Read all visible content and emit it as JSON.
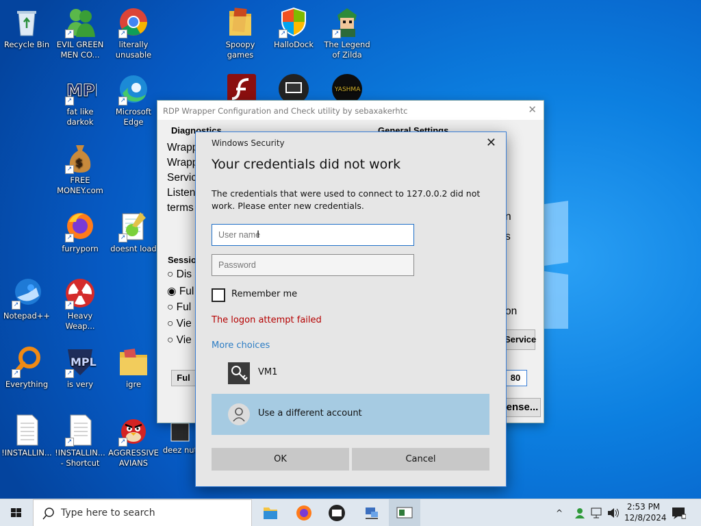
{
  "desktop": {
    "icons": [
      {
        "id": "recycle",
        "label": "Recycle Bin",
        "icon": "recycle-bin-icon",
        "shortcut": false
      },
      {
        "id": "evil",
        "label": "EVIL GREEN MEN CO...",
        "icon": "messenger-people-icon",
        "shortcut": true
      },
      {
        "id": "chrome",
        "label": "literally unusable",
        "icon": "chrome-icon",
        "shortcut": true
      },
      {
        "id": "spoopy",
        "label": "Spoopy games",
        "icon": "folder-icon",
        "shortcut": false
      },
      {
        "id": "hallodock",
        "label": "HalloDock",
        "icon": "shield-icon",
        "shortcut": true
      },
      {
        "id": "zilda",
        "label": "The Legend of Zilda",
        "icon": "game-character-icon",
        "shortcut": true
      },
      {
        "id": "fatlike",
        "label": "fat like darkok",
        "icon": "mpl-logo-icon",
        "shortcut": true
      },
      {
        "id": "edge",
        "label": "Microsoft Edge",
        "icon": "edge-icon",
        "shortcut": true
      },
      {
        "id": "flash",
        "label": "",
        "icon": "flash-icon",
        "shortcut": false
      },
      {
        "id": "rdpicon",
        "label": "",
        "icon": "rdp-monitor-icon",
        "shortcut": false
      },
      {
        "id": "yashma",
        "label": "",
        "icon": "yashma-icon",
        "shortcut": false
      },
      {
        "id": "money",
        "label": "FREE MONEY.com",
        "icon": "money-bag-icon",
        "shortcut": true
      },
      {
        "id": "firefox",
        "label": "furryporn",
        "icon": "firefox-icon",
        "shortcut": true
      },
      {
        "id": "notepad",
        "label": "Notepad++",
        "icon": "notepad-plus-icon",
        "shortcut": true
      },
      {
        "id": "thunder",
        "label": "doesnt load",
        "icon": "thunderbird-icon",
        "shortcut": true
      },
      {
        "id": "heavy",
        "label": "Heavy Weap...",
        "icon": "radiation-icon",
        "shortcut": true
      },
      {
        "id": "everything",
        "label": "Everything",
        "icon": "magnifier-icon",
        "shortcut": true
      },
      {
        "id": "isvery",
        "label": "is very",
        "icon": "mpl-shield-icon",
        "shortcut": true
      },
      {
        "id": "igre",
        "label": "igre",
        "icon": "folder-icon",
        "shortcut": false
      },
      {
        "id": "install1",
        "label": "!INSTALLIN...",
        "icon": "document-icon",
        "shortcut": false
      },
      {
        "id": "install2",
        "label": "!INSTALLIN... - Shortcut",
        "icon": "document-icon",
        "shortcut": true
      },
      {
        "id": "angry",
        "label": "AGGRESSIVE AVIANS",
        "icon": "angry-bird-icon",
        "shortcut": true
      },
      {
        "id": "deez",
        "label": "deez nut",
        "icon": "terminal-icon",
        "shortcut": false
      }
    ]
  },
  "rdp_window": {
    "title": "RDP Wrapper Configuration and Check utility by sebaxakerhtc",
    "diagnostics_label": "Diagnostics",
    "general_label": "General Settings",
    "diag_lines": [
      "Wrapp",
      "Wrapp",
      "Servic",
      "Listen",
      "terms"
    ],
    "session_label": "Sessio",
    "radios": [
      "Dis",
      "Ful",
      "Ful",
      "Vie",
      "Vie"
    ],
    "right_fragments": [
      "n",
      "s",
      "on"
    ],
    "service_btn": "Service",
    "port_value": "80",
    "full_btn": "Ful",
    "license_btn": "ense..."
  },
  "dialog": {
    "header": "Windows Security",
    "title": "Your credentials did not work",
    "message": "The credentials that were used to connect to 127.0.0.2 did not work. Please enter new credentials.",
    "username_placeholder": "User name",
    "password_placeholder": "Password",
    "remember_label": "Remember me",
    "remember_checked": false,
    "error": "The logon attempt failed",
    "more_choices": "More choices",
    "accounts": [
      {
        "label": "VM1",
        "icon": "key-icon",
        "selected": false
      },
      {
        "label": "Use a different account",
        "icon": "person-icon",
        "selected": true
      }
    ],
    "ok_label": "OK",
    "cancel_label": "Cancel",
    "accent_color": "#2b7cc4",
    "error_color": "#b50000"
  },
  "taskbar": {
    "search_placeholder": "Type here to search",
    "pinned": [
      "file-explorer-icon",
      "firefox-icon",
      "terminal-icon",
      "network-computer-icon",
      "rdp-config-icon"
    ],
    "time": "2:53 PM",
    "date": "12/8/2024"
  }
}
